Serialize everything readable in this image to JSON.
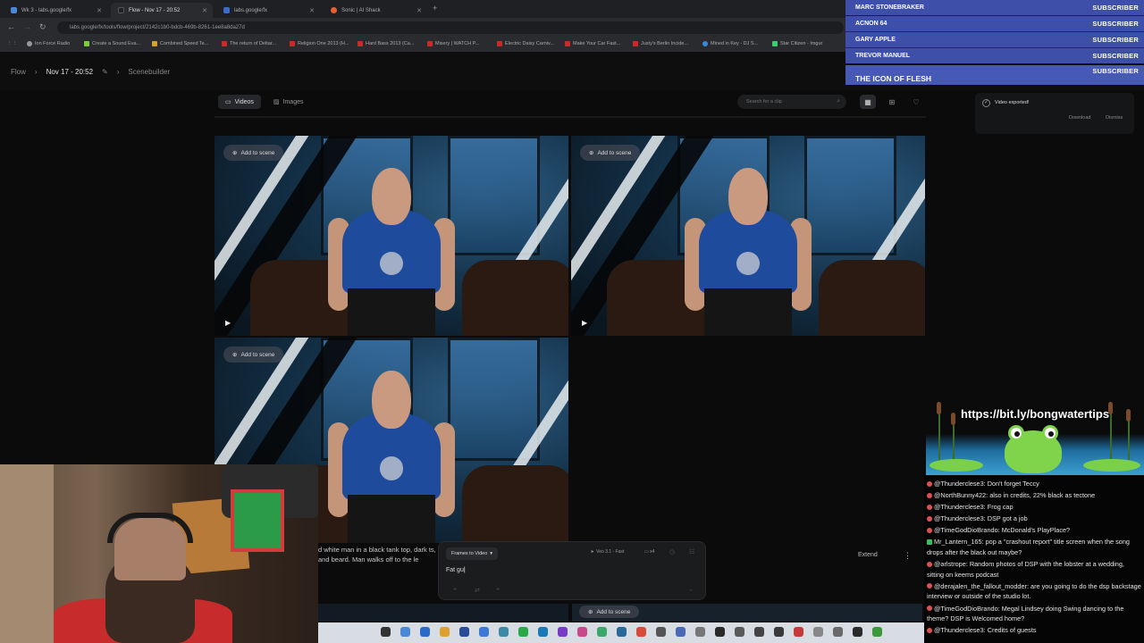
{
  "browser": {
    "tabs": [
      {
        "label": "Wk 3 - labs.google/fx",
        "color": "#4a88d8"
      },
      {
        "label": "Flow - Nov 17 - 20:52",
        "color": "#202124"
      },
      {
        "label": "labs.google/fx",
        "color": "#3a6bc8"
      },
      {
        "label": "Sonic | AI Shack",
        "color": "#e86030"
      }
    ],
    "url": "labs.google/fx/tools/flow/project/2142c1b0-bdcb-469b-8261-1ee8a8da27d",
    "bookmarks": [
      {
        "label": "Ion Force Radio",
        "color": "#999"
      },
      {
        "label": "Create a Sound Eva...",
        "color": "#7ccf3a"
      },
      {
        "label": "Combined Speed Te...",
        "color": "#d8a030"
      },
      {
        "label": "The return of Deltar...",
        "color": "#cc2a2a"
      },
      {
        "label": "Religion One 2013 (H...",
        "color": "#cc2a2a"
      },
      {
        "label": "Hard Bass 2013 (Ca...",
        "color": "#cc2a2a"
      },
      {
        "label": "Misery | WATCH P...",
        "color": "#cc2a2a"
      },
      {
        "label": "Electric Daisy Carniv...",
        "color": "#cc2a2a"
      },
      {
        "label": "Make Your Car Fast...",
        "color": "#cc2a2a"
      },
      {
        "label": "Justy's Berlin Incide...",
        "color": "#cc2a2a"
      },
      {
        "label": "Mined in Key - DJ S...",
        "color": "#3a88d8"
      },
      {
        "label": "Star Citizen - Imgur",
        "color": "#3acf6a"
      }
    ]
  },
  "app": {
    "crumbs": {
      "root": "Flow",
      "project": "Nov 17 - 20:52",
      "section": "Scenebuilder"
    },
    "segments": {
      "videos": "Videos",
      "images": "Images"
    },
    "search_placeholder": "Search for a clip",
    "add_to_scene": "Add to scene",
    "prompt": {
      "mode": "Frames to Video",
      "model": "Veo 3.1 - Fast",
      "count": "x4",
      "text": "Fat gu"
    },
    "description": "d white man in a black tank top, dark ts, and beard. Man walks off to the le",
    "extend": "Extend"
  },
  "toast": {
    "message": "Video exported!",
    "download": "Download",
    "dismiss": "Dismiss"
  },
  "subscribers": [
    {
      "name": "MARC STONEBRAKER",
      "tag": "SUBSCRIBER"
    },
    {
      "name": "ACNON 64",
      "tag": "SUBSCRIBER"
    },
    {
      "name": "GARY APPLE",
      "tag": "SUBSCRIBER"
    },
    {
      "name": "TREVOR MANUEL",
      "tag": "SUBSCRIBER"
    },
    {
      "name": "THE ICON OF FLESH",
      "tag": "SUBSCRIBER"
    }
  ],
  "banner_url": "https://bit.ly/bongwatertips",
  "chat": [
    {
      "user": "@Thunderclese3:",
      "text": "Don't forget Teccy",
      "color": "#e05050"
    },
    {
      "user": "@NorthBunny422:",
      "text": "also in credits, 22% black as tectone",
      "color": "#e05050"
    },
    {
      "user": "@Thunderclese3:",
      "text": "Frog cap",
      "color": "#e05050"
    },
    {
      "user": "@Thunderclese3:",
      "text": "DSP got a job",
      "color": "#e05050"
    },
    {
      "user": "@TimeGodDioBrando:",
      "text": "McDonald's PlayPlace?",
      "color": "#e05050"
    },
    {
      "user": "Mr_Lantern_165:",
      "text": "pop a \"crashout report\" title screen when the song drops after the black out maybe?",
      "color": "#3ac05a"
    },
    {
      "user": "@arlstrope:",
      "text": "Random photos of DSP with the lobster at a wedding, sitting on keems podcast",
      "color": "#e05050"
    },
    {
      "user": "@derajalen_the_fallout_modder:",
      "text": "are you going to do the dsp backstage interview or outside of the studio lot.",
      "color": "#e05050"
    },
    {
      "user": "@TimeGodDioBrando:",
      "text": "Megal Lindsey doing Swing dancing to the theme? DSP is Welcomed home?",
      "color": "#e05050"
    },
    {
      "user": "@Thunderclese3:",
      "text": "Credits of guests",
      "color": "#e05050"
    }
  ],
  "colors": {
    "subscriber_bg": "#3d4fa8",
    "accent": "#4659b4"
  }
}
